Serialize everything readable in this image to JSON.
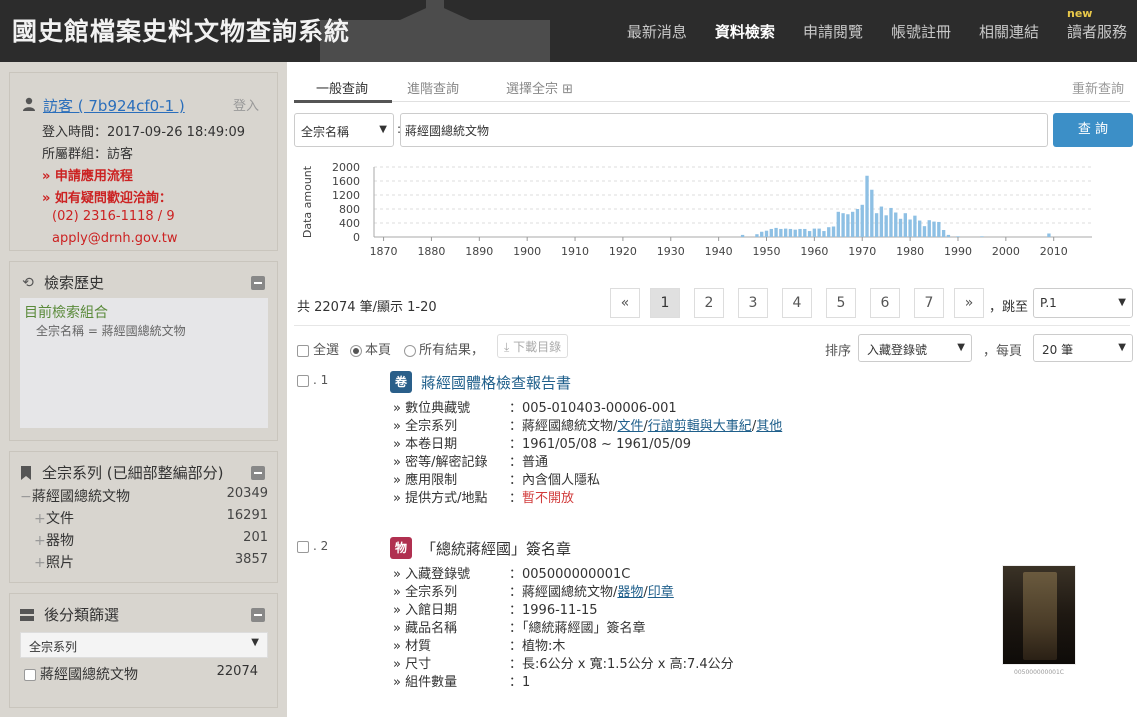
{
  "header": {
    "title": "國史館檔案史料文物查詢系統",
    "nav": [
      {
        "label": "最新消息",
        "active": false
      },
      {
        "label": "資料檢索",
        "active": true
      },
      {
        "label": "申請閱覽",
        "active": false
      },
      {
        "label": "帳號註冊",
        "active": false
      },
      {
        "label": "相關連結",
        "active": false
      },
      {
        "label": "讀者服務",
        "active": false,
        "badge": "new"
      }
    ]
  },
  "user_panel": {
    "name": "訪客 ( 7b924cf0-1 )",
    "login": "登入",
    "login_time": "登入時間：2017-09-26 18:49:09",
    "group": "所屬群組：訪客",
    "apply_flow": "» 申請應用流程",
    "contact_heading": "» 如有疑問歡迎洽詢：",
    "phone": "(02) 2316-1118 / 9",
    "email": "apply@drnh.gov.tw"
  },
  "history_panel": {
    "title": "檢索歷史",
    "current_label": "目前檢索組合",
    "condition": "全宗名稱 = 蔣經國總統文物"
  },
  "series_panel": {
    "title": "全宗系列 (已細部整編部分)",
    "root": {
      "label": "蔣經國總統文物",
      "count": "20349"
    },
    "children": [
      {
        "label": "文件",
        "count": "16291"
      },
      {
        "label": "器物",
        "count": "201"
      },
      {
        "label": "照片",
        "count": "3857"
      }
    ]
  },
  "filter_panel": {
    "title": "後分類篩選",
    "select_value": "全宗系列",
    "option": {
      "label": "蔣經國總統文物",
      "count": "22074"
    }
  },
  "tabs": {
    "items": [
      "一般查詢",
      "進階查詢",
      "選擇全宗 ⊞"
    ],
    "active_index": 0,
    "reset": "重新查詢"
  },
  "search": {
    "field": "全宗名稱",
    "colon": ":",
    "value": "蔣經國總統文物",
    "button": "查 詢"
  },
  "chart_data": {
    "type": "bar",
    "ylabel": "Data amount",
    "xlim": [
      1868,
      2018
    ],
    "ylim": [
      0,
      2000
    ],
    "yticks": [
      0,
      400,
      800,
      1200,
      1600,
      2000
    ],
    "xticks": [
      1870,
      1880,
      1890,
      1900,
      1910,
      1920,
      1930,
      1940,
      1950,
      1960,
      1970,
      1980,
      1990,
      2000,
      2010
    ],
    "grid": true,
    "x": [
      1945,
      1948,
      1949,
      1950,
      1951,
      1952,
      1953,
      1954,
      1955,
      1956,
      1957,
      1958,
      1959,
      1960,
      1961,
      1962,
      1963,
      1964,
      1965,
      1966,
      1967,
      1968,
      1969,
      1970,
      1971,
      1972,
      1973,
      1974,
      1975,
      1976,
      1977,
      1978,
      1979,
      1980,
      1981,
      1982,
      1983,
      1984,
      1985,
      1986,
      1987,
      1988,
      1990,
      1995,
      2009
    ],
    "values": [
      60,
      80,
      150,
      180,
      230,
      260,
      230,
      240,
      230,
      210,
      230,
      230,
      170,
      240,
      240,
      170,
      280,
      300,
      720,
      680,
      650,
      720,
      800,
      920,
      1750,
      1350,
      680,
      870,
      620,
      830,
      700,
      520,
      680,
      500,
      610,
      470,
      310,
      480,
      440,
      430,
      200,
      60,
      20,
      20,
      100
    ]
  },
  "pager": {
    "total": "共 22074 筆/顯示 1-20",
    "pages": [
      "«",
      "1",
      "2",
      "3",
      "4",
      "5",
      "6",
      "7",
      "»"
    ],
    "active_page": "1",
    "jump_label": "，跳至",
    "jump_value": "P.1"
  },
  "options": {
    "select_all": "全選",
    "this_page": "本頁",
    "all_results": "所有結果，",
    "download": "下載目錄",
    "sort_label": "排序",
    "sort_value": "入藏登錄號",
    "per_page_label": "，每頁",
    "per_page_value": "20 筆"
  },
  "results": [
    {
      "num": ". 1",
      "badge": "卷",
      "title": "蔣經國體格檢查報告書",
      "fields": [
        {
          "label": "» 數位典藏號",
          "value": "：005-010403-00006-001"
        },
        {
          "label": "» 全宗系列",
          "value_parts": [
            "：蔣經國總統文物/",
            "文件",
            "/",
            "行誼剪輯與大事紀",
            "/",
            "其他"
          ]
        },
        {
          "label": "» 本卷日期",
          "value": "：1961/05/08 ~ 1961/05/09"
        },
        {
          "label": "» 密等/解密記錄",
          "value": "：普通"
        },
        {
          "label": "» 應用限制",
          "value": "：內含個人隱私"
        },
        {
          "label": "» 提供方式/地點",
          "value": "：",
          "value_red": "暫不開放"
        }
      ]
    },
    {
      "num": ". 2",
      "badge": "物",
      "title": "「總統蔣經國」簽名章",
      "thumb_caption": "005000000001C",
      "fields": [
        {
          "label": "» 入藏登錄號",
          "value": "：005000000001C"
        },
        {
          "label": "» 全宗系列",
          "value_parts": [
            "：蔣經國總統文物/",
            "器物",
            "/",
            "印章"
          ]
        },
        {
          "label": "» 入館日期",
          "value": "：1996-11-15"
        },
        {
          "label": "» 藏品名稱",
          "value": "：「總統蔣經國」簽名章"
        },
        {
          "label": "» 材質",
          "value": "：植物:木"
        },
        {
          "label": "» 尺寸",
          "value": "：長:6公分 x 寬:1.5公分 x 高:7.4公分"
        },
        {
          "label": "» 組件數量",
          "value": "：1"
        }
      ]
    }
  ]
}
